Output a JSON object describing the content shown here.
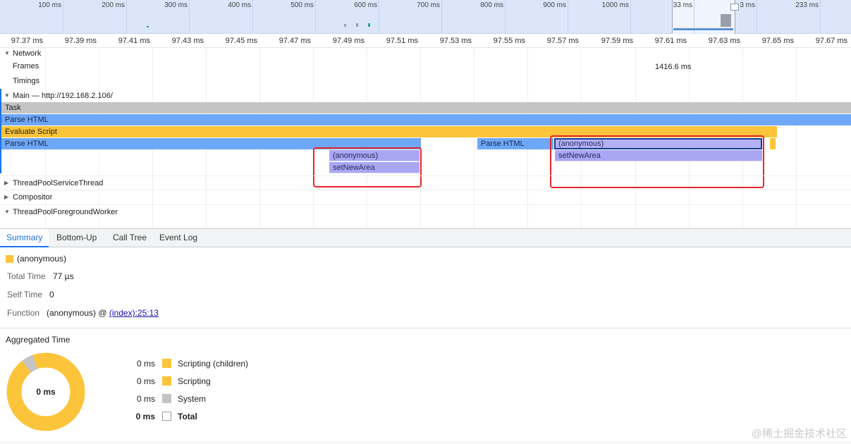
{
  "overview": {
    "ticks": [
      "100 ms",
      "200 ms",
      "300 ms",
      "400 ms",
      "500 ms",
      "600 ms",
      "700 ms",
      "800 ms",
      "900 ms",
      "1000 ms",
      "33 ms",
      "3 ms",
      "233 ms"
    ]
  },
  "ruler": {
    "ticks": [
      "97.37 ms",
      "97.39 ms",
      "97.41 ms",
      "97.43 ms",
      "97.45 ms",
      "97.47 ms",
      "97.49 ms",
      "97.51 ms",
      "97.53 ms",
      "97.55 ms",
      "97.57 ms",
      "97.59 ms",
      "97.61 ms",
      "97.63 ms",
      "97.65 ms",
      "97.67 ms"
    ]
  },
  "tracks": {
    "network": "Network",
    "frames": "Frames",
    "frames_value": "1416.6 ms",
    "timings": "Timings",
    "main": "Main — http://192.168.2.106/",
    "threadpool_service": "ThreadPoolServiceThread",
    "compositor": "Compositor",
    "threadpool_foreground": "ThreadPoolForegroundWorker"
  },
  "flame": {
    "task": "Task",
    "parse_html": "Parse HTML",
    "evaluate_script": "Evaluate Script",
    "parse_html_2": "Parse HTML",
    "anonymous_1": "(anonymous)",
    "set_new_area_1": "setNewArea",
    "parse_html_3": "Parse HTML",
    "anonymous_2": "(anonymous)",
    "set_new_area_2": "setNewArea"
  },
  "tabs": [
    "Summary",
    "Bottom-Up",
    "Call Tree",
    "Event Log"
  ],
  "summary": {
    "title": "(anonymous)",
    "swatch_color": "#fbc43a",
    "total_time_label": "Total Time",
    "total_time_value": "77 µs",
    "self_time_label": "Self Time",
    "self_time_value": "0",
    "function_label": "Function",
    "function_value": "(anonymous) @ ",
    "function_link": "(index):25:13"
  },
  "aggregated": {
    "title": "Aggregated Time",
    "center": "0 ms",
    "rows": [
      {
        "value": "0 ms",
        "name": "Scripting (children)",
        "color": "#fbc43a"
      },
      {
        "value": "0 ms",
        "name": "Scripting",
        "color": "#fbc43a"
      },
      {
        "value": "0 ms",
        "name": "System",
        "color": "#c4c4c4"
      },
      {
        "value": "0 ms",
        "name": "Total",
        "color": "#ffffff"
      }
    ]
  },
  "watermark": "@稀土掘金技术社区"
}
